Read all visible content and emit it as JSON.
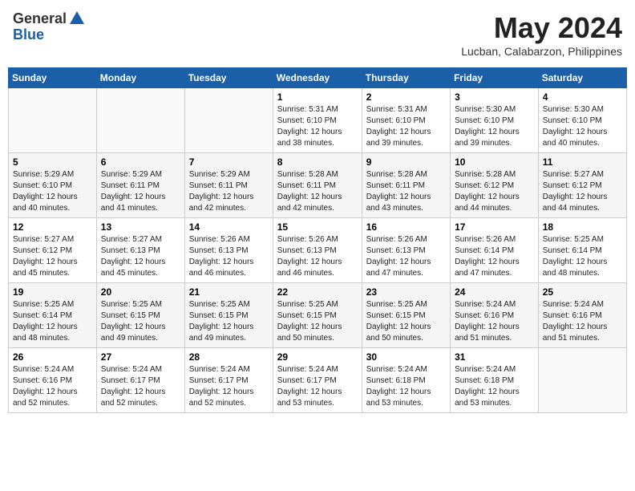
{
  "header": {
    "logo_general": "General",
    "logo_blue": "Blue",
    "month_title": "May 2024",
    "location": "Lucban, Calabarzon, Philippines"
  },
  "days_of_week": [
    "Sunday",
    "Monday",
    "Tuesday",
    "Wednesday",
    "Thursday",
    "Friday",
    "Saturday"
  ],
  "weeks": [
    [
      {
        "day": "",
        "info": ""
      },
      {
        "day": "",
        "info": ""
      },
      {
        "day": "",
        "info": ""
      },
      {
        "day": "1",
        "info": "Sunrise: 5:31 AM\nSunset: 6:10 PM\nDaylight: 12 hours\nand 38 minutes."
      },
      {
        "day": "2",
        "info": "Sunrise: 5:31 AM\nSunset: 6:10 PM\nDaylight: 12 hours\nand 39 minutes."
      },
      {
        "day": "3",
        "info": "Sunrise: 5:30 AM\nSunset: 6:10 PM\nDaylight: 12 hours\nand 39 minutes."
      },
      {
        "day": "4",
        "info": "Sunrise: 5:30 AM\nSunset: 6:10 PM\nDaylight: 12 hours\nand 40 minutes."
      }
    ],
    [
      {
        "day": "5",
        "info": "Sunrise: 5:29 AM\nSunset: 6:10 PM\nDaylight: 12 hours\nand 40 minutes."
      },
      {
        "day": "6",
        "info": "Sunrise: 5:29 AM\nSunset: 6:11 PM\nDaylight: 12 hours\nand 41 minutes."
      },
      {
        "day": "7",
        "info": "Sunrise: 5:29 AM\nSunset: 6:11 PM\nDaylight: 12 hours\nand 42 minutes."
      },
      {
        "day": "8",
        "info": "Sunrise: 5:28 AM\nSunset: 6:11 PM\nDaylight: 12 hours\nand 42 minutes."
      },
      {
        "day": "9",
        "info": "Sunrise: 5:28 AM\nSunset: 6:11 PM\nDaylight: 12 hours\nand 43 minutes."
      },
      {
        "day": "10",
        "info": "Sunrise: 5:28 AM\nSunset: 6:12 PM\nDaylight: 12 hours\nand 44 minutes."
      },
      {
        "day": "11",
        "info": "Sunrise: 5:27 AM\nSunset: 6:12 PM\nDaylight: 12 hours\nand 44 minutes."
      }
    ],
    [
      {
        "day": "12",
        "info": "Sunrise: 5:27 AM\nSunset: 6:12 PM\nDaylight: 12 hours\nand 45 minutes."
      },
      {
        "day": "13",
        "info": "Sunrise: 5:27 AM\nSunset: 6:13 PM\nDaylight: 12 hours\nand 45 minutes."
      },
      {
        "day": "14",
        "info": "Sunrise: 5:26 AM\nSunset: 6:13 PM\nDaylight: 12 hours\nand 46 minutes."
      },
      {
        "day": "15",
        "info": "Sunrise: 5:26 AM\nSunset: 6:13 PM\nDaylight: 12 hours\nand 46 minutes."
      },
      {
        "day": "16",
        "info": "Sunrise: 5:26 AM\nSunset: 6:13 PM\nDaylight: 12 hours\nand 47 minutes."
      },
      {
        "day": "17",
        "info": "Sunrise: 5:26 AM\nSunset: 6:14 PM\nDaylight: 12 hours\nand 47 minutes."
      },
      {
        "day": "18",
        "info": "Sunrise: 5:25 AM\nSunset: 6:14 PM\nDaylight: 12 hours\nand 48 minutes."
      }
    ],
    [
      {
        "day": "19",
        "info": "Sunrise: 5:25 AM\nSunset: 6:14 PM\nDaylight: 12 hours\nand 48 minutes."
      },
      {
        "day": "20",
        "info": "Sunrise: 5:25 AM\nSunset: 6:15 PM\nDaylight: 12 hours\nand 49 minutes."
      },
      {
        "day": "21",
        "info": "Sunrise: 5:25 AM\nSunset: 6:15 PM\nDaylight: 12 hours\nand 49 minutes."
      },
      {
        "day": "22",
        "info": "Sunrise: 5:25 AM\nSunset: 6:15 PM\nDaylight: 12 hours\nand 50 minutes."
      },
      {
        "day": "23",
        "info": "Sunrise: 5:25 AM\nSunset: 6:15 PM\nDaylight: 12 hours\nand 50 minutes."
      },
      {
        "day": "24",
        "info": "Sunrise: 5:24 AM\nSunset: 6:16 PM\nDaylight: 12 hours\nand 51 minutes."
      },
      {
        "day": "25",
        "info": "Sunrise: 5:24 AM\nSunset: 6:16 PM\nDaylight: 12 hours\nand 51 minutes."
      }
    ],
    [
      {
        "day": "26",
        "info": "Sunrise: 5:24 AM\nSunset: 6:16 PM\nDaylight: 12 hours\nand 52 minutes."
      },
      {
        "day": "27",
        "info": "Sunrise: 5:24 AM\nSunset: 6:17 PM\nDaylight: 12 hours\nand 52 minutes."
      },
      {
        "day": "28",
        "info": "Sunrise: 5:24 AM\nSunset: 6:17 PM\nDaylight: 12 hours\nand 52 minutes."
      },
      {
        "day": "29",
        "info": "Sunrise: 5:24 AM\nSunset: 6:17 PM\nDaylight: 12 hours\nand 53 minutes."
      },
      {
        "day": "30",
        "info": "Sunrise: 5:24 AM\nSunset: 6:18 PM\nDaylight: 12 hours\nand 53 minutes."
      },
      {
        "day": "31",
        "info": "Sunrise: 5:24 AM\nSunset: 6:18 PM\nDaylight: 12 hours\nand 53 minutes."
      },
      {
        "day": "",
        "info": ""
      }
    ]
  ]
}
